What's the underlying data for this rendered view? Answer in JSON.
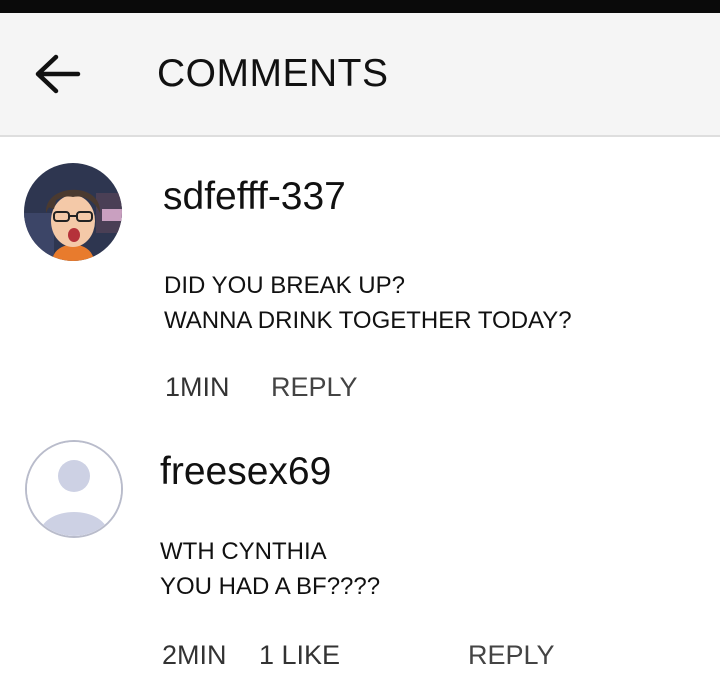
{
  "header": {
    "back_icon": "arrow-left-icon",
    "title": "COMMENTS"
  },
  "comments": [
    {
      "username": "sdfefff-337",
      "avatar": "illustrated-avatar",
      "lines": [
        "DID YOU BREAK UP?",
        "WANNA DRINK TOGETHER TODAY?"
      ],
      "time": "1MIN",
      "likes": "",
      "reply_label": "REPLY"
    },
    {
      "username": "freesex69",
      "avatar": "default-user-icon",
      "lines": [
        "WTH CYNTHIA",
        "YOU HAD A BF????"
      ],
      "time": "2MIN",
      "likes": "1 LIKE",
      "reply_label": "REPLY"
    }
  ],
  "colors": {
    "header_bg": "#f5f5f5",
    "topbar": "#0a0a0a",
    "placeholder_avatar": "#cdd1e4"
  }
}
